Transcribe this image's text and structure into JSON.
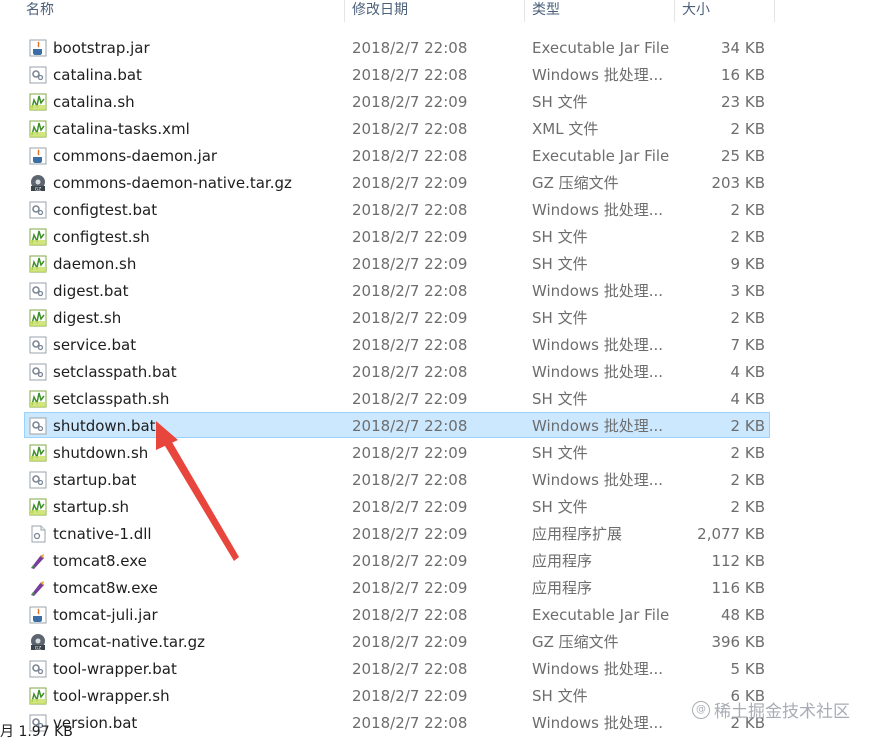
{
  "columns": {
    "name": "名称",
    "date": "修改日期",
    "type": "类型",
    "size": "大小"
  },
  "files": [
    {
      "name": "bootstrap.jar",
      "date": "2018/2/7 22:08",
      "type": "Executable Jar File",
      "size": "34 KB",
      "icon": "jar-icon"
    },
    {
      "name": "catalina.bat",
      "date": "2018/2/7 22:08",
      "type": "Windows 批处理...",
      "size": "16 KB",
      "icon": "bat-icon"
    },
    {
      "name": "catalina.sh",
      "date": "2018/2/7 22:09",
      "type": "SH 文件",
      "size": "23 KB",
      "icon": "sh-icon"
    },
    {
      "name": "catalina-tasks.xml",
      "date": "2018/2/7 22:08",
      "type": "XML 文件",
      "size": "2 KB",
      "icon": "xml-icon"
    },
    {
      "name": "commons-daemon.jar",
      "date": "2018/2/7 22:08",
      "type": "Executable Jar File",
      "size": "25 KB",
      "icon": "jar-icon"
    },
    {
      "name": "commons-daemon-native.tar.gz",
      "date": "2018/2/7 22:09",
      "type": "GZ 压缩文件",
      "size": "203 KB",
      "icon": "gz-icon"
    },
    {
      "name": "configtest.bat",
      "date": "2018/2/7 22:08",
      "type": "Windows 批处理...",
      "size": "2 KB",
      "icon": "bat-icon"
    },
    {
      "name": "configtest.sh",
      "date": "2018/2/7 22:09",
      "type": "SH 文件",
      "size": "2 KB",
      "icon": "sh-icon"
    },
    {
      "name": "daemon.sh",
      "date": "2018/2/7 22:09",
      "type": "SH 文件",
      "size": "9 KB",
      "icon": "sh-icon"
    },
    {
      "name": "digest.bat",
      "date": "2018/2/7 22:08",
      "type": "Windows 批处理...",
      "size": "3 KB",
      "icon": "bat-icon"
    },
    {
      "name": "digest.sh",
      "date": "2018/2/7 22:09",
      "type": "SH 文件",
      "size": "2 KB",
      "icon": "sh-icon"
    },
    {
      "name": "service.bat",
      "date": "2018/2/7 22:08",
      "type": "Windows 批处理...",
      "size": "7 KB",
      "icon": "bat-icon"
    },
    {
      "name": "setclasspath.bat",
      "date": "2018/2/7 22:08",
      "type": "Windows 批处理...",
      "size": "4 KB",
      "icon": "bat-icon"
    },
    {
      "name": "setclasspath.sh",
      "date": "2018/2/7 22:09",
      "type": "SH 文件",
      "size": "4 KB",
      "icon": "sh-icon"
    },
    {
      "name": "shutdown.bat",
      "date": "2018/2/7 22:08",
      "type": "Windows 批处理...",
      "size": "2 KB",
      "icon": "bat-icon",
      "selected": true
    },
    {
      "name": "shutdown.sh",
      "date": "2018/2/7 22:09",
      "type": "SH 文件",
      "size": "2 KB",
      "icon": "sh-icon"
    },
    {
      "name": "startup.bat",
      "date": "2018/2/7 22:08",
      "type": "Windows 批处理...",
      "size": "2 KB",
      "icon": "bat-icon"
    },
    {
      "name": "startup.sh",
      "date": "2018/2/7 22:09",
      "type": "SH 文件",
      "size": "2 KB",
      "icon": "sh-icon"
    },
    {
      "name": "tcnative-1.dll",
      "date": "2018/2/7 22:09",
      "type": "应用程序扩展",
      "size": "2,077 KB",
      "icon": "dll-icon"
    },
    {
      "name": "tomcat8.exe",
      "date": "2018/2/7 22:09",
      "type": "应用程序",
      "size": "112 KB",
      "icon": "exe-icon"
    },
    {
      "name": "tomcat8w.exe",
      "date": "2018/2/7 22:09",
      "type": "应用程序",
      "size": "116 KB",
      "icon": "exe-icon"
    },
    {
      "name": "tomcat-juli.jar",
      "date": "2018/2/7 22:08",
      "type": "Executable Jar File",
      "size": "48 KB",
      "icon": "jar-icon"
    },
    {
      "name": "tomcat-native.tar.gz",
      "date": "2018/2/7 22:09",
      "type": "GZ 压缩文件",
      "size": "396 KB",
      "icon": "gz-icon"
    },
    {
      "name": "tool-wrapper.bat",
      "date": "2018/2/7 22:08",
      "type": "Windows 批处理...",
      "size": "5 KB",
      "icon": "bat-icon"
    },
    {
      "name": "tool-wrapper.sh",
      "date": "2018/2/7 22:09",
      "type": "SH 文件",
      "size": "6 KB",
      "icon": "sh-icon"
    },
    {
      "name": "version.bat",
      "date": "2018/2/7 22:08",
      "type": "Windows 批处理...",
      "size": "2 KB",
      "icon": "bat-icon"
    }
  ],
  "status_text": "月 1.97 KB",
  "watermark": "稀土掘金技术社区",
  "colors": {
    "selection": "#cce8ff",
    "selection_border": "#99d1ff",
    "arrow": "#e8463c",
    "header_text": "#4c607a"
  }
}
